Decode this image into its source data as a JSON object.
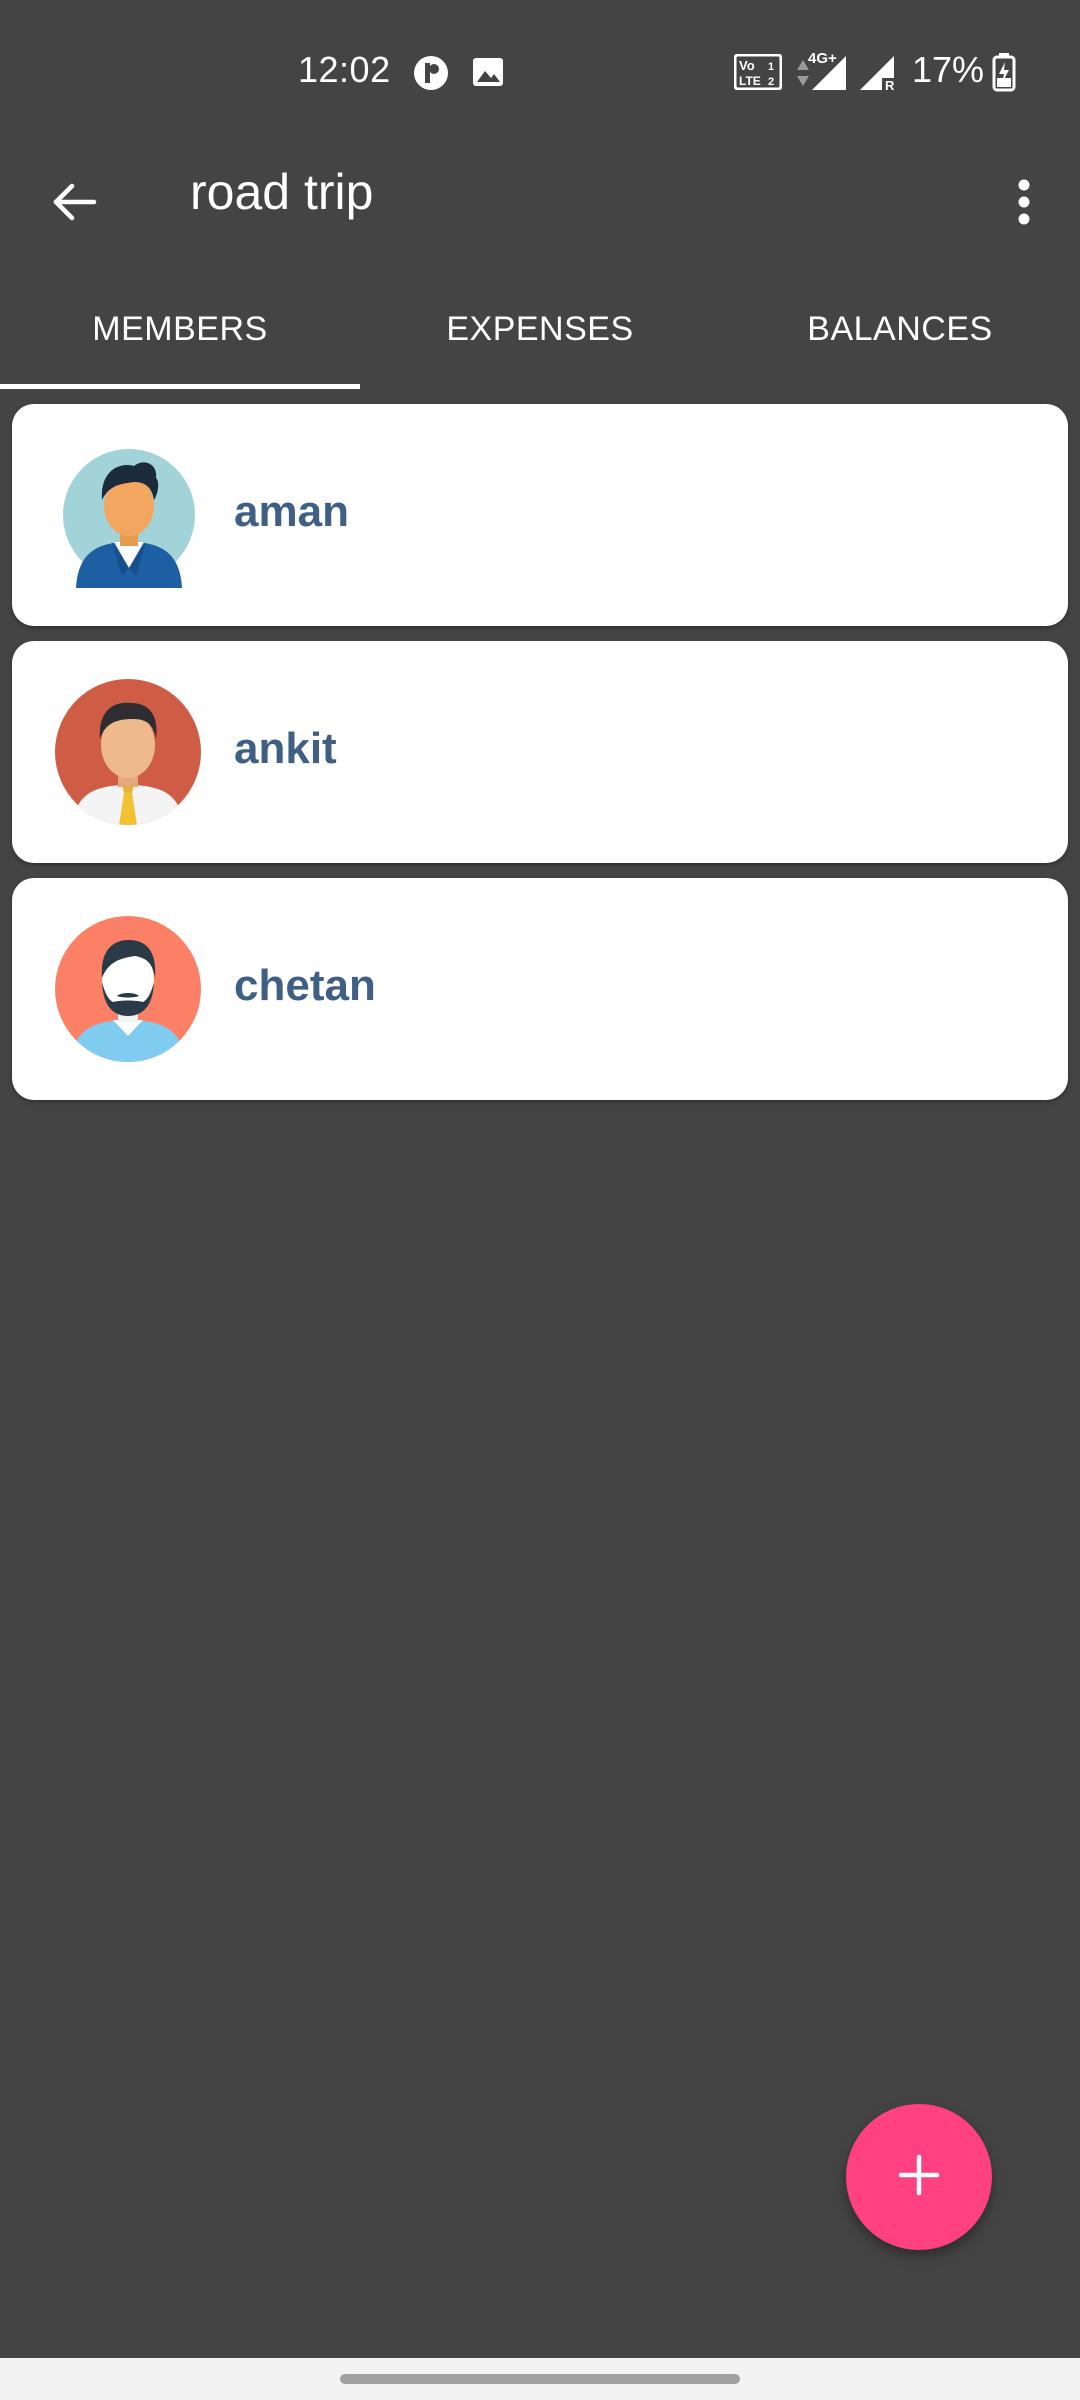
{
  "status_bar": {
    "time": "12:02",
    "battery_percent": "17%",
    "network_label": "4G+",
    "icons": [
      "app-notification-icon",
      "gallery-icon",
      "volte-icon",
      "data-arrows-icon",
      "signal-icon",
      "signal-roaming-icon",
      "battery-charging-icon"
    ]
  },
  "app_bar": {
    "title": "road trip",
    "back_icon": "arrow-back-icon",
    "more_icon": "more-vert-icon"
  },
  "tabs": [
    {
      "label": "MEMBERS",
      "selected": true
    },
    {
      "label": "EXPENSES",
      "selected": false
    },
    {
      "label": "BALANCES",
      "selected": false
    }
  ],
  "members": [
    {
      "name": "aman",
      "avatar": "avatar-man-blue-suit-icon"
    },
    {
      "name": "ankit",
      "avatar": "avatar-man-tie-icon"
    },
    {
      "name": "chetan",
      "avatar": "avatar-man-beard-icon"
    }
  ],
  "fab": {
    "icon": "add-icon"
  },
  "colors": {
    "background": "#444444",
    "card": "#ffffff",
    "member_name": "#3f5f85",
    "fab": "#ff4081",
    "tab_indicator": "#ffffff"
  }
}
